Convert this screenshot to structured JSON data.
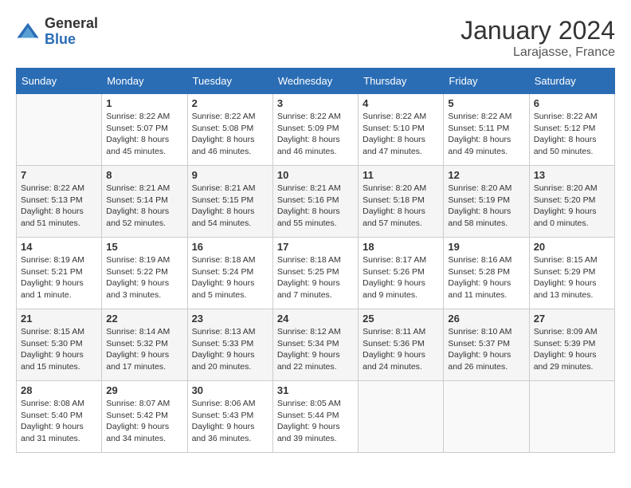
{
  "logo": {
    "text_general": "General",
    "text_blue": "Blue"
  },
  "title": "January 2024",
  "subtitle": "Larajasse, France",
  "days_of_week": [
    "Sunday",
    "Monday",
    "Tuesday",
    "Wednesday",
    "Thursday",
    "Friday",
    "Saturday"
  ],
  "weeks": [
    [
      {
        "day": "",
        "info": ""
      },
      {
        "day": "1",
        "info": "Sunrise: 8:22 AM\nSunset: 5:07 PM\nDaylight: 8 hours\nand 45 minutes."
      },
      {
        "day": "2",
        "info": "Sunrise: 8:22 AM\nSunset: 5:08 PM\nDaylight: 8 hours\nand 46 minutes."
      },
      {
        "day": "3",
        "info": "Sunrise: 8:22 AM\nSunset: 5:09 PM\nDaylight: 8 hours\nand 46 minutes."
      },
      {
        "day": "4",
        "info": "Sunrise: 8:22 AM\nSunset: 5:10 PM\nDaylight: 8 hours\nand 47 minutes."
      },
      {
        "day": "5",
        "info": "Sunrise: 8:22 AM\nSunset: 5:11 PM\nDaylight: 8 hours\nand 49 minutes."
      },
      {
        "day": "6",
        "info": "Sunrise: 8:22 AM\nSunset: 5:12 PM\nDaylight: 8 hours\nand 50 minutes."
      }
    ],
    [
      {
        "day": "7",
        "info": "Sunrise: 8:22 AM\nSunset: 5:13 PM\nDaylight: 8 hours\nand 51 minutes."
      },
      {
        "day": "8",
        "info": "Sunrise: 8:21 AM\nSunset: 5:14 PM\nDaylight: 8 hours\nand 52 minutes."
      },
      {
        "day": "9",
        "info": "Sunrise: 8:21 AM\nSunset: 5:15 PM\nDaylight: 8 hours\nand 54 minutes."
      },
      {
        "day": "10",
        "info": "Sunrise: 8:21 AM\nSunset: 5:16 PM\nDaylight: 8 hours\nand 55 minutes."
      },
      {
        "day": "11",
        "info": "Sunrise: 8:20 AM\nSunset: 5:18 PM\nDaylight: 8 hours\nand 57 minutes."
      },
      {
        "day": "12",
        "info": "Sunrise: 8:20 AM\nSunset: 5:19 PM\nDaylight: 8 hours\nand 58 minutes."
      },
      {
        "day": "13",
        "info": "Sunrise: 8:20 AM\nSunset: 5:20 PM\nDaylight: 9 hours\nand 0 minutes."
      }
    ],
    [
      {
        "day": "14",
        "info": "Sunrise: 8:19 AM\nSunset: 5:21 PM\nDaylight: 9 hours\nand 1 minute."
      },
      {
        "day": "15",
        "info": "Sunrise: 8:19 AM\nSunset: 5:22 PM\nDaylight: 9 hours\nand 3 minutes."
      },
      {
        "day": "16",
        "info": "Sunrise: 8:18 AM\nSunset: 5:24 PM\nDaylight: 9 hours\nand 5 minutes."
      },
      {
        "day": "17",
        "info": "Sunrise: 8:18 AM\nSunset: 5:25 PM\nDaylight: 9 hours\nand 7 minutes."
      },
      {
        "day": "18",
        "info": "Sunrise: 8:17 AM\nSunset: 5:26 PM\nDaylight: 9 hours\nand 9 minutes."
      },
      {
        "day": "19",
        "info": "Sunrise: 8:16 AM\nSunset: 5:28 PM\nDaylight: 9 hours\nand 11 minutes."
      },
      {
        "day": "20",
        "info": "Sunrise: 8:15 AM\nSunset: 5:29 PM\nDaylight: 9 hours\nand 13 minutes."
      }
    ],
    [
      {
        "day": "21",
        "info": "Sunrise: 8:15 AM\nSunset: 5:30 PM\nDaylight: 9 hours\nand 15 minutes."
      },
      {
        "day": "22",
        "info": "Sunrise: 8:14 AM\nSunset: 5:32 PM\nDaylight: 9 hours\nand 17 minutes."
      },
      {
        "day": "23",
        "info": "Sunrise: 8:13 AM\nSunset: 5:33 PM\nDaylight: 9 hours\nand 20 minutes."
      },
      {
        "day": "24",
        "info": "Sunrise: 8:12 AM\nSunset: 5:34 PM\nDaylight: 9 hours\nand 22 minutes."
      },
      {
        "day": "25",
        "info": "Sunrise: 8:11 AM\nSunset: 5:36 PM\nDaylight: 9 hours\nand 24 minutes."
      },
      {
        "day": "26",
        "info": "Sunrise: 8:10 AM\nSunset: 5:37 PM\nDaylight: 9 hours\nand 26 minutes."
      },
      {
        "day": "27",
        "info": "Sunrise: 8:09 AM\nSunset: 5:39 PM\nDaylight: 9 hours\nand 29 minutes."
      }
    ],
    [
      {
        "day": "28",
        "info": "Sunrise: 8:08 AM\nSunset: 5:40 PM\nDaylight: 9 hours\nand 31 minutes."
      },
      {
        "day": "29",
        "info": "Sunrise: 8:07 AM\nSunset: 5:42 PM\nDaylight: 9 hours\nand 34 minutes."
      },
      {
        "day": "30",
        "info": "Sunrise: 8:06 AM\nSunset: 5:43 PM\nDaylight: 9 hours\nand 36 minutes."
      },
      {
        "day": "31",
        "info": "Sunrise: 8:05 AM\nSunset: 5:44 PM\nDaylight: 9 hours\nand 39 minutes."
      },
      {
        "day": "",
        "info": ""
      },
      {
        "day": "",
        "info": ""
      },
      {
        "day": "",
        "info": ""
      }
    ]
  ]
}
